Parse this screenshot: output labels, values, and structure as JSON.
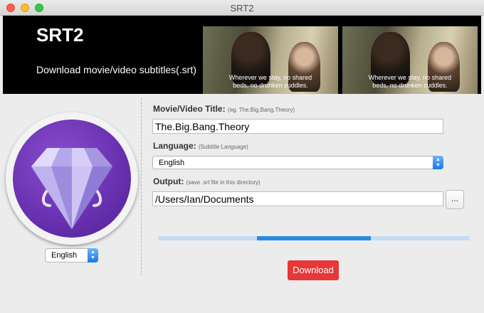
{
  "window": {
    "title": "SRT2"
  },
  "banner": {
    "title": "SRT2",
    "subtitle": "Download movie/video subtitles(.srt)",
    "stills": [
      {
        "subtitle_line1": "Wherever we stay, no shared",
        "subtitle_line2": "beds, no drunken cuddles."
      },
      {
        "subtitle_line1": "Wherever we stay, no shared",
        "subtitle_line2": "beds, no drunken cuddles."
      }
    ]
  },
  "sidebar": {
    "language_select": {
      "value": "English"
    }
  },
  "form": {
    "title_label": "Movie/Video Title:",
    "title_hint": "(eg. The.Big.Bang.Theory)",
    "title_value": "The.Big.Bang.Theory",
    "language_label": "Language:",
    "language_hint": "(Subtitle Language)",
    "language_value": "English",
    "output_label": "Output:",
    "output_hint": "(save .srt file in this directory)",
    "output_value": "/Users/Ian/Documents",
    "browse_label": "..."
  },
  "progress": {
    "indeterminate": true
  },
  "actions": {
    "download_label": "Download"
  },
  "colors": {
    "accent": "#2a8ae2",
    "download": "#e73737",
    "icon": "#6a32b2"
  },
  "icons": {
    "app": "diamond-icon",
    "chevron": "chevron-updown-icon"
  }
}
